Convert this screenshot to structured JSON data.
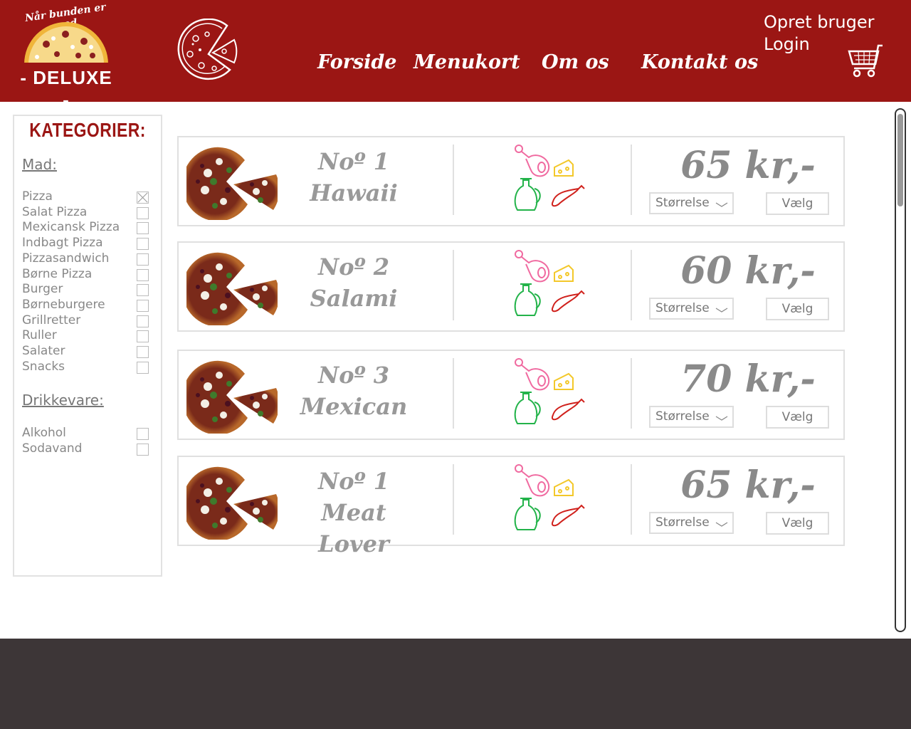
{
  "header": {
    "logo": {
      "tagline": "Når bunden er god",
      "name": "- DELUXE -"
    },
    "nav": [
      {
        "label": "Forside"
      },
      {
        "label": "Menukort"
      },
      {
        "label": "Om os"
      },
      {
        "label": "Kontakt os"
      }
    ],
    "account": {
      "signup": "Opret bruger",
      "login": "Login"
    },
    "brand_color": "#9b1614"
  },
  "sidebar": {
    "title": "KATEGORIER:",
    "food_heading": "Mad:",
    "food_items": [
      {
        "label": "Pizza",
        "checked": true
      },
      {
        "label": "Salat Pizza",
        "checked": false
      },
      {
        "label": "Mexicansk Pizza",
        "checked": false
      },
      {
        "label": "Indbagt Pizza",
        "checked": false
      },
      {
        "label": "Pizzasandwich",
        "checked": false
      },
      {
        "label": "Børne Pizza",
        "checked": false
      },
      {
        "label": "Burger",
        "checked": false
      },
      {
        "label": "Børneburgere",
        "checked": false
      },
      {
        "label": "Grillretter",
        "checked": false
      },
      {
        "label": "Ruller",
        "checked": false
      },
      {
        "label": "Salater",
        "checked": false
      },
      {
        "label": "Snacks",
        "checked": false
      }
    ],
    "drink_heading": "Drikkevare:",
    "drink_items": [
      {
        "label": "Alkohol",
        "checked": false
      },
      {
        "label": "Sodavand",
        "checked": false
      }
    ]
  },
  "menu": {
    "items": [
      {
        "number": "Noº 1",
        "name": "Hawaii",
        "price": "65 kr,-",
        "size_label": "Størrelse",
        "choose_label": "Vælg"
      },
      {
        "number": "Noº 2",
        "name": "Salami",
        "price": "60 kr,-",
        "size_label": "Størrelse",
        "choose_label": "Vælg"
      },
      {
        "number": "Noº 3",
        "name": "Mexican",
        "price": "70 kr,-",
        "size_label": "Størrelse",
        "choose_label": "Vælg"
      },
      {
        "number": "Noº 1",
        "name": "Meat Lover",
        "price": "65 kr,-",
        "size_label": "Størrelse",
        "choose_label": "Vælg"
      }
    ]
  },
  "icons": [
    "pizza-logo-icon",
    "pizza-outline-icon",
    "cart-icon",
    "ham-icon",
    "cheese-icon",
    "oil-icon",
    "chili-icon",
    "chevron-down-icon"
  ],
  "colors": {
    "footer": "#3d3637",
    "ham": "#f06aa0",
    "cheese": "#f3c82a",
    "oil": "#23b34a",
    "chili": "#d0211c"
  }
}
